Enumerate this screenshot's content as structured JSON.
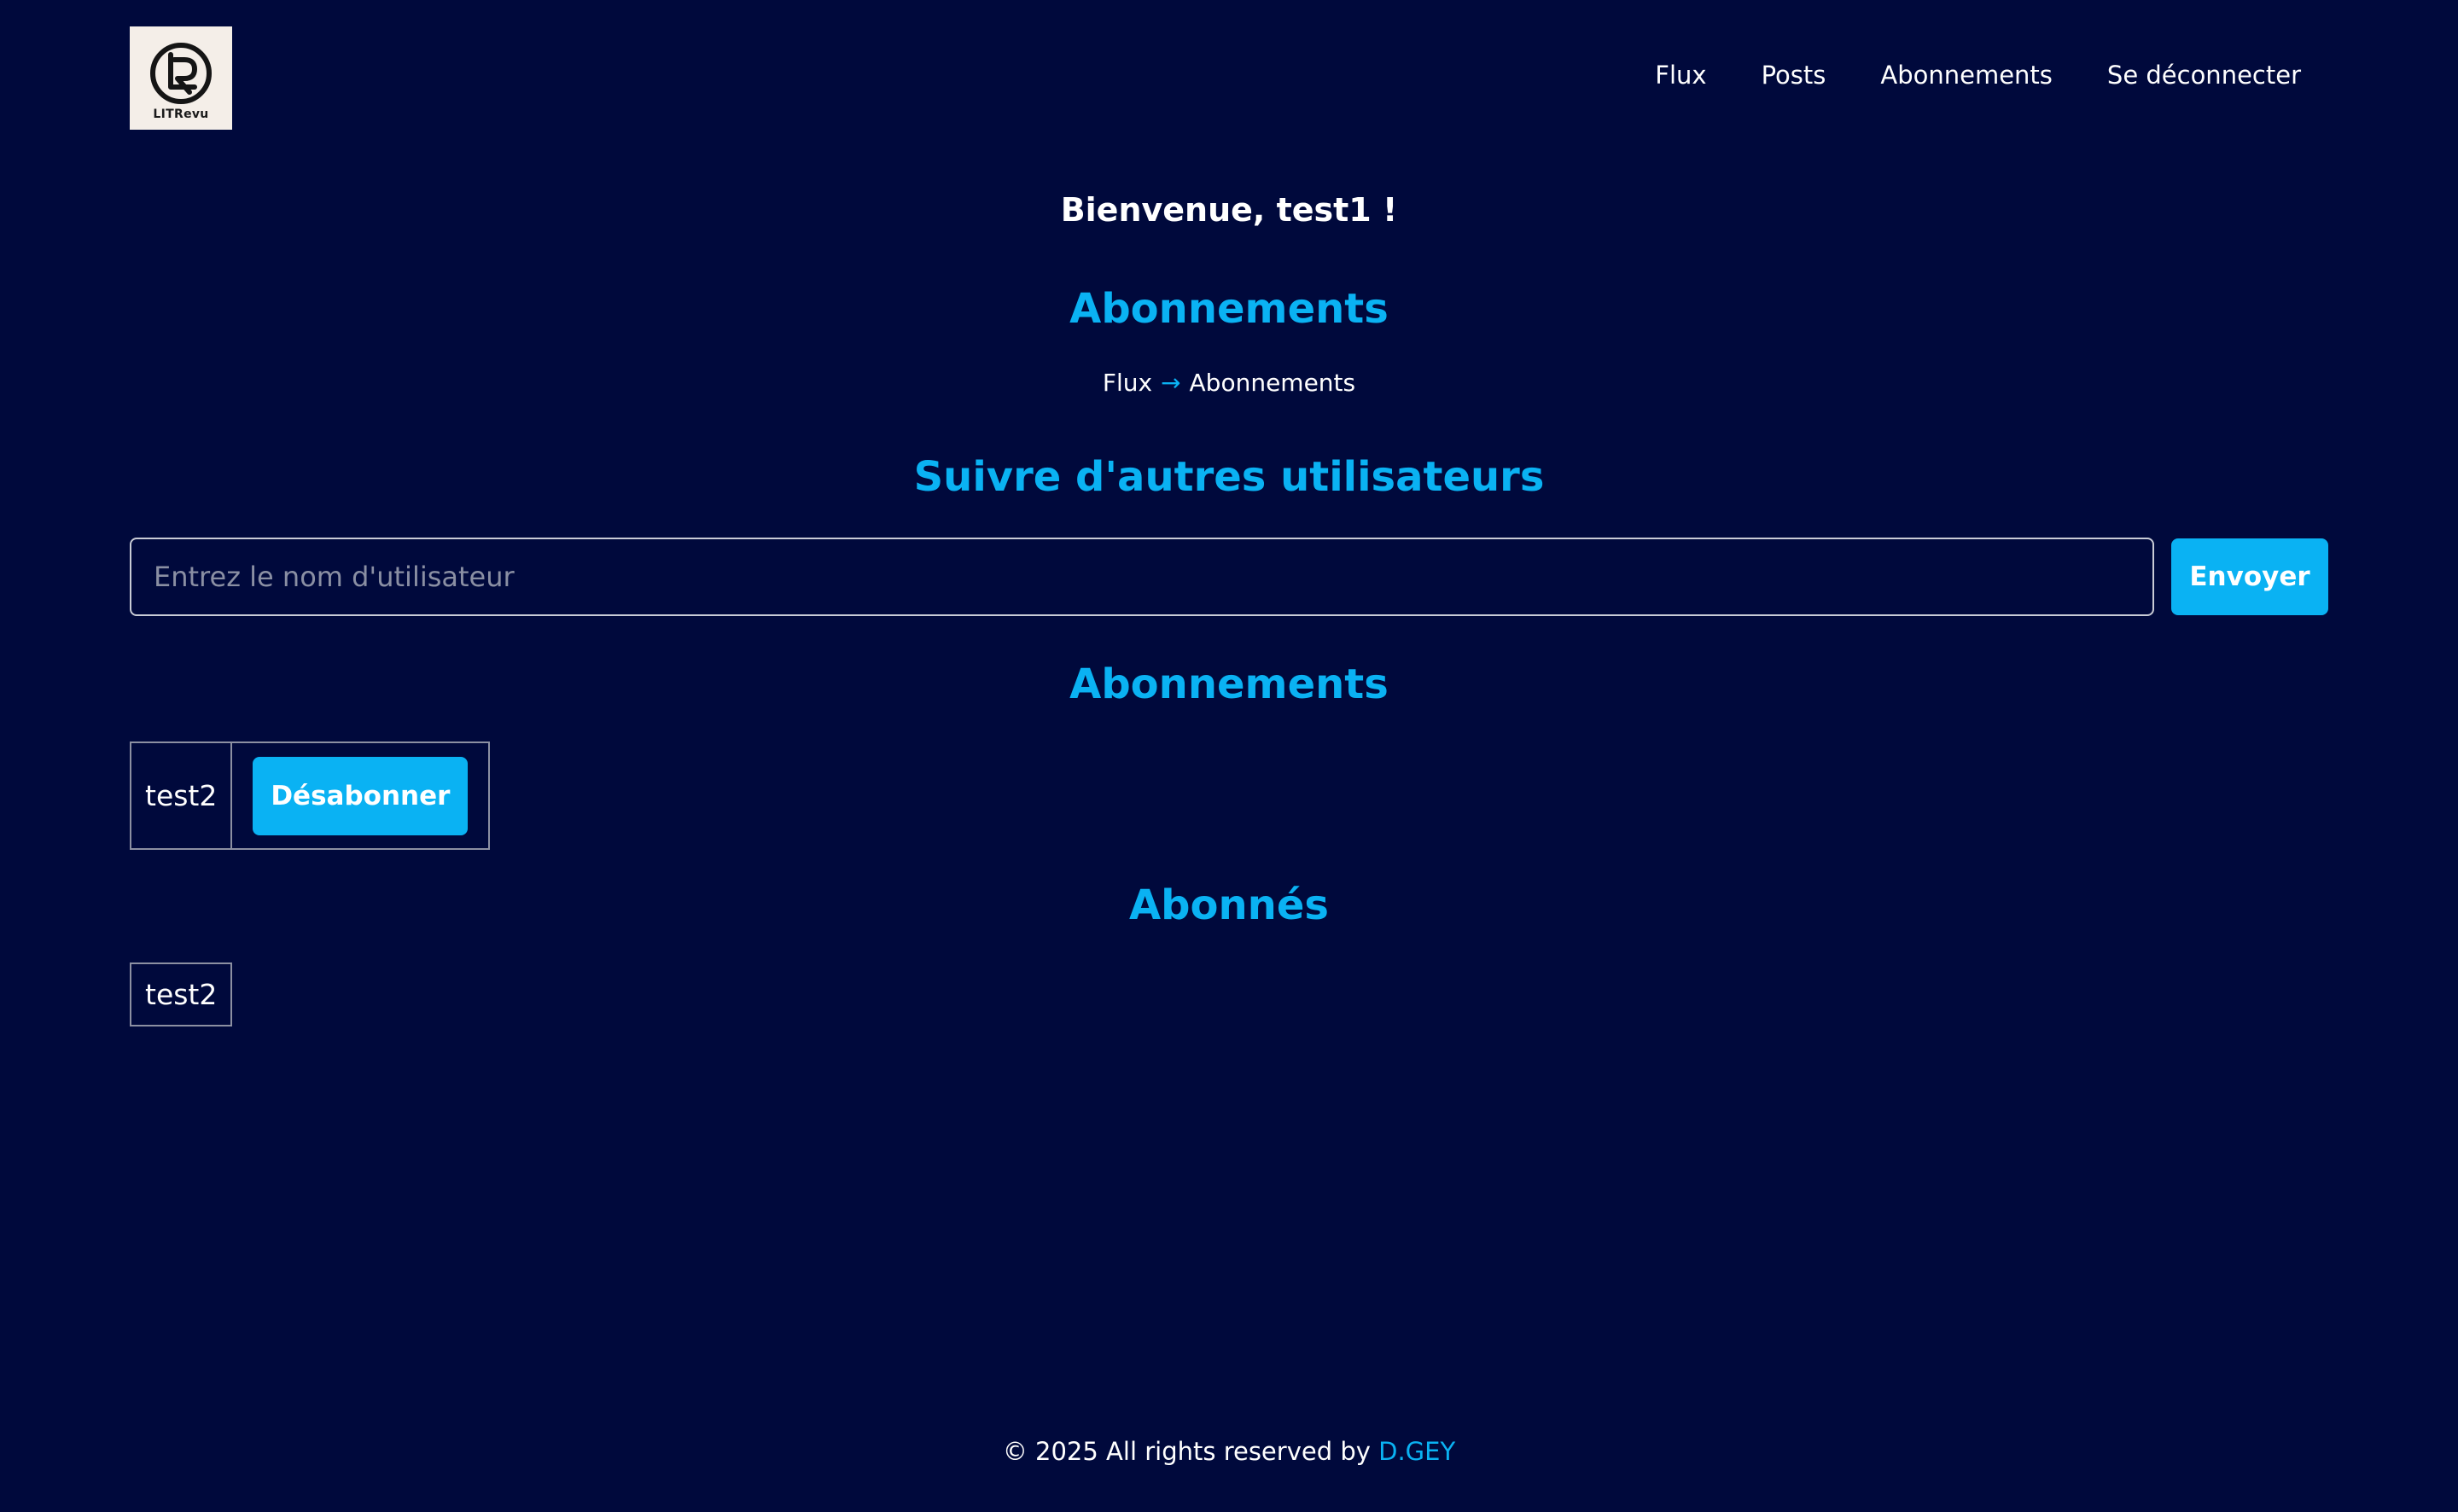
{
  "header": {
    "logo": {
      "icon": "litrevu-logo-icon",
      "text": "LITRevu"
    },
    "nav": [
      {
        "label": "Flux"
      },
      {
        "label": "Posts"
      },
      {
        "label": "Abonnements"
      },
      {
        "label": "Se déconnecter"
      }
    ]
  },
  "welcome": "Bienvenue, test1 !",
  "page_title": "Abonnements",
  "breadcrumb": {
    "home": "Flux",
    "separator": "→",
    "current": "Abonnements"
  },
  "follow_section": {
    "title": "Suivre d'autres utilisateurs",
    "input": {
      "placeholder": "Entrez le nom d'utilisateur",
      "value": ""
    },
    "submit_label": "Envoyer"
  },
  "subscriptions": {
    "title": "Abonnements",
    "rows": [
      {
        "username": "test2",
        "action_label": "Désabonner"
      }
    ]
  },
  "followers": {
    "title": "Abonnés",
    "rows": [
      {
        "username": "test2"
      }
    ]
  },
  "footer": {
    "text": "© 2025 All rights reserved by",
    "author": "D.GEY"
  },
  "colors": {
    "background": "#00093c",
    "accent": "#0ab2f3",
    "text": "#ffffff"
  }
}
